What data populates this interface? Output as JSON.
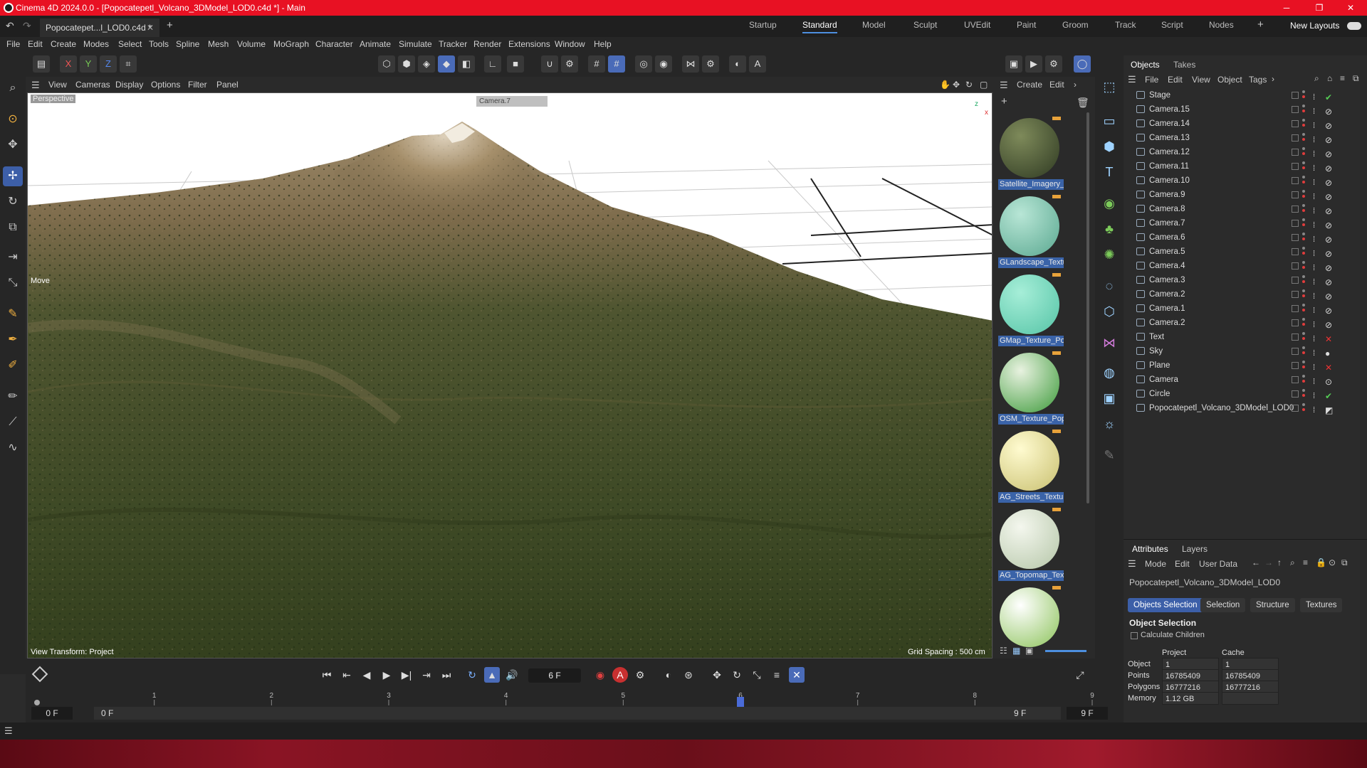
{
  "title_bar": {
    "title": "Cinema 4D 2024.0.0 - [Popocatepetl_Volcano_3DModel_LOD0.c4d *] - Main"
  },
  "document_tab": {
    "label": "Popocatepet...l_LOD0.c4d *"
  },
  "layouts": [
    "Startup",
    "Standard",
    "Model",
    "Sculpt",
    "UVEdit",
    "Paint",
    "Groom",
    "Track",
    "Script",
    "Nodes"
  ],
  "active_layout": "Standard",
  "new_layouts": "New Layouts",
  "menus": [
    "File",
    "Edit",
    "Create",
    "Modes",
    "Select",
    "Tools",
    "Spline",
    "Mesh",
    "Volume",
    "MoGraph",
    "Character",
    "Animate",
    "Simulate",
    "Tracker",
    "Render",
    "Extensions",
    "Window",
    "Help"
  ],
  "axis_buttons": [
    "X",
    "Y",
    "Z"
  ],
  "viewport": {
    "menus": [
      "View",
      "Cameras",
      "Display",
      "Options",
      "Filter",
      "Panel"
    ],
    "projection": "Perspective",
    "camera": "Camera.7",
    "tool_label": "Move",
    "view_transform": "View Transform: Project",
    "grid_spacing": "Grid Spacing : 500 cm",
    "axis_x": "x",
    "axis_z": "z"
  },
  "material_manager": {
    "menus": [
      "Create",
      "Edit"
    ],
    "materials": [
      {
        "name": "Satellite_Imagery_",
        "c1": "#7e8a5a",
        "c2": "#2f3a22"
      },
      {
        "name": "GLandscape_Textu",
        "c1": "#b8e6d6",
        "c2": "#5aa890"
      },
      {
        "name": "GMap_Texture_Po",
        "c1": "#a6eed8",
        "c2": "#55c4a6"
      },
      {
        "name": "OSM_Texture_Pop",
        "c1": "#e8f2e0",
        "c2": "#3d9a3a"
      },
      {
        "name": "AG_Streets_Textur",
        "c1": "#fffbd0",
        "c2": "#c9c070"
      },
      {
        "name": "AG_Topomap_Tex",
        "c1": "#f4f7ee",
        "c2": "#b5c6a8"
      },
      {
        "name": "",
        "c1": "#ffffff",
        "c2": "#8cc35a"
      }
    ]
  },
  "object_manager": {
    "tabs": [
      "Objects",
      "Takes"
    ],
    "menus": [
      "File",
      "Edit",
      "View",
      "Object",
      "Tags"
    ],
    "objects": [
      {
        "name": "Stage",
        "tag": "✔"
      },
      {
        "name": "Camera.15",
        "tag": "⊘"
      },
      {
        "name": "Camera.14",
        "tag": "⊘"
      },
      {
        "name": "Camera.13",
        "tag": "⊘"
      },
      {
        "name": "Camera.12",
        "tag": "⊘"
      },
      {
        "name": "Camera.11",
        "tag": "⊘"
      },
      {
        "name": "Camera.10",
        "tag": "⊘"
      },
      {
        "name": "Camera.9",
        "tag": "⊘"
      },
      {
        "name": "Camera.8",
        "tag": "⊘"
      },
      {
        "name": "Camera.7",
        "tag": "⊘"
      },
      {
        "name": "Camera.6",
        "tag": "⊘"
      },
      {
        "name": "Camera.5",
        "tag": "⊘"
      },
      {
        "name": "Camera.4",
        "tag": "⊘"
      },
      {
        "name": "Camera.3",
        "tag": "⊘"
      },
      {
        "name": "Camera.2",
        "tag": "⊘"
      },
      {
        "name": "Camera.1",
        "tag": "⊘"
      },
      {
        "name": "Camera.2",
        "tag": "⊘"
      },
      {
        "name": "Text",
        "tag": "✕"
      },
      {
        "name": "Sky",
        "tag": "●"
      },
      {
        "name": "Plane",
        "tag": "✕"
      },
      {
        "name": "Camera",
        "tag": "⊙"
      },
      {
        "name": "Circle",
        "tag": "✔"
      },
      {
        "name": "Popocatepetl_Volcano_3DModel_LOD0",
        "tag": "◩"
      }
    ]
  },
  "attributes": {
    "tabs": [
      "Attributes",
      "Layers"
    ],
    "menus": [
      "Mode",
      "Edit",
      "User Data"
    ],
    "object_name": "Popocatepetl_Volcano_3DModel_LOD0",
    "subtabs": [
      "Objects Selection",
      "Selection",
      "Structure",
      "Textures"
    ],
    "section": "Object Selection",
    "checkbox": "Calculate Children",
    "col_project": "Project",
    "col_cache": "Cache",
    "rows": [
      {
        "label": "Object",
        "project": "1",
        "cache": "1"
      },
      {
        "label": "Points",
        "project": "16785409",
        "cache": "16785409"
      },
      {
        "label": "Polygons",
        "project": "16777216",
        "cache": "16777216"
      },
      {
        "label": "Memory",
        "project": "1.12 GB",
        "cache": ""
      }
    ]
  },
  "timeline": {
    "current_frame": "6 F",
    "ruler": [
      "1",
      "2",
      "3",
      "4",
      "5",
      "6",
      "7",
      "8",
      "9"
    ],
    "ruler_start": "0",
    "start": "0 F",
    "range_start": "0 F",
    "range_end": "9 F",
    "end": "9 F",
    "playhead": 6,
    "max_frame": 9
  }
}
